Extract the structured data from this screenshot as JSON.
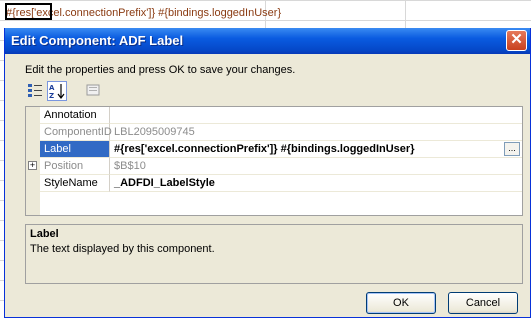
{
  "spreadsheet": {
    "cell_text_prefix": "#{res['exc",
    "cell_text_rest": "el.connectionPrefix']} #{bindings.loggedInUser}"
  },
  "dialog": {
    "title": "Edit Component: ADF Label",
    "close_glyph": "✕",
    "instructions": "Edit the properties and press OK to save your changes.",
    "toolbar": {
      "categorized_icon": "categorized-icon",
      "alphabetical_icon": "alphabetical-icon",
      "property_pages_icon": "property-pages-icon"
    },
    "properties": [
      {
        "name": "Annotation",
        "value": ""
      },
      {
        "name": "ComponentID",
        "value": "LBL2095009745"
      },
      {
        "name": "Label",
        "value": "#{res['excel.connectionPrefix']} #{bindings.loggedInUser}"
      },
      {
        "name": "Position",
        "value": "$B$10"
      },
      {
        "name": "StyleName",
        "value": "_ADFDI_LabelStyle"
      }
    ],
    "ellipsis_label": "...",
    "expander_glyph": "+",
    "help": {
      "title": "Label",
      "description": "The text displayed by this component."
    },
    "buttons": {
      "ok": "OK",
      "cancel": "Cancel"
    }
  },
  "colors": {
    "titlebar": "#0548c8",
    "selection": "#316ac5",
    "cell_text": "#8a3b12"
  }
}
